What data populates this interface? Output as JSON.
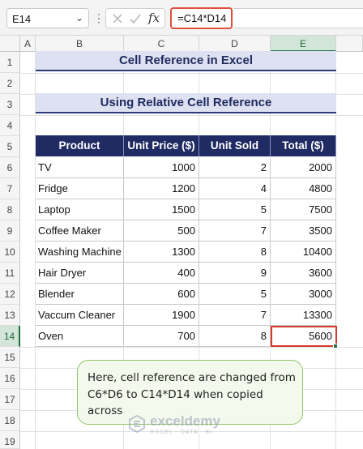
{
  "formula_bar": {
    "name_box": "E14",
    "name_box_chevron": "chevron-down-icon",
    "kebab": "⋮",
    "fx_label": "fx",
    "formula": "=C14*D14"
  },
  "columns": [
    "A",
    "B",
    "C",
    "D",
    "E"
  ],
  "selected_column": "E",
  "rows": [
    "1",
    "2",
    "3",
    "4",
    "5",
    "6",
    "7",
    "8",
    "9",
    "10",
    "11",
    "12",
    "13",
    "14",
    "15",
    "16",
    "17",
    "18",
    "19"
  ],
  "selected_row": "14",
  "titles": {
    "main": "Cell Reference in Excel",
    "sub": "Using Relative Cell Reference"
  },
  "table": {
    "headers": [
      "Product",
      "Unit Price ($)",
      "Unit Sold",
      "Total ($)"
    ],
    "rows": [
      [
        "TV",
        "1000",
        "2",
        "2000"
      ],
      [
        "Fridge",
        "1200",
        "4",
        "4800"
      ],
      [
        "Laptop",
        "1500",
        "5",
        "7500"
      ],
      [
        "Coffee Maker",
        "500",
        "7",
        "3500"
      ],
      [
        "Washing Machine",
        "1300",
        "8",
        "10400"
      ],
      [
        "Hair Dryer",
        "400",
        "9",
        "3600"
      ],
      [
        "Blender",
        "600",
        "5",
        "3000"
      ],
      [
        "Vaccum Cleaner",
        "1900",
        "7",
        "13300"
      ],
      [
        "Oven",
        "700",
        "8",
        "5600"
      ]
    ]
  },
  "callout": {
    "text": "Here, cell reference are changed from C6*D6 to C14*D14 when copied across"
  },
  "watermark": {
    "name": "exceldemy",
    "tagline": "EXCEL · DATA · BI"
  },
  "colors": {
    "header_fill": "#202a63",
    "title_fill": "#dde1f1",
    "active_border": "#d63a2a",
    "callout_border": "#8fc46a"
  }
}
